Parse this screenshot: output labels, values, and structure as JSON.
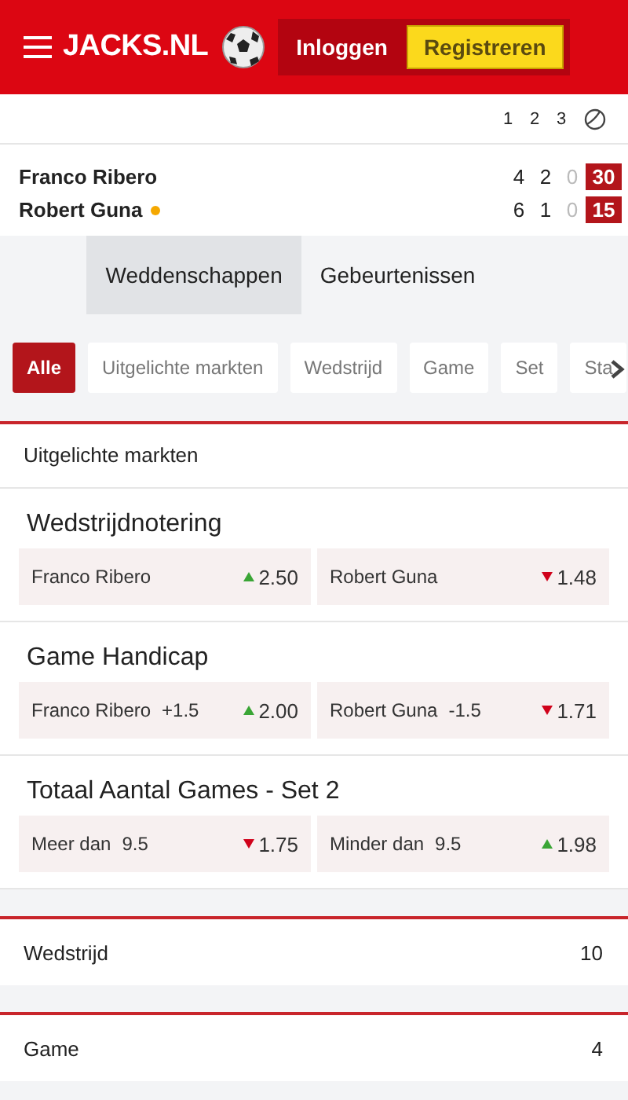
{
  "header": {
    "logo": "JACKS.NL",
    "login": "Inloggen",
    "register": "Registreren"
  },
  "scoreboard": {
    "columns": [
      "1",
      "2",
      "3"
    ],
    "players": [
      {
        "name": "Franco Ribero",
        "serving": false,
        "sets": [
          {
            "value": "4",
            "dim": false
          },
          {
            "value": "2",
            "dim": false
          },
          {
            "value": "0",
            "dim": true
          }
        ],
        "points": "30"
      },
      {
        "name": "Robert Guna",
        "serving": true,
        "sets": [
          {
            "value": "6",
            "dim": false
          },
          {
            "value": "1",
            "dim": false
          },
          {
            "value": "0",
            "dim": true
          }
        ],
        "points": "15"
      }
    ]
  },
  "tabs": [
    {
      "label": "Weddenschappen",
      "selected": true
    },
    {
      "label": "Gebeurtenissen",
      "selected": false
    }
  ],
  "filters": [
    {
      "label": "Alle",
      "selected": true
    },
    {
      "label": "Uitgelichte markten",
      "selected": false
    },
    {
      "label": "Wedstrijd",
      "selected": false
    },
    {
      "label": "Game",
      "selected": false
    },
    {
      "label": "Set",
      "selected": false
    },
    {
      "label": "Sta",
      "selected": false
    }
  ],
  "featured_title": "Uitgelichte markten",
  "markets": [
    {
      "title": "Wedstrijdnotering",
      "outcomes": [
        {
          "name": "Franco Ribero",
          "odds": "2.50",
          "rising": true
        },
        {
          "name": "Robert Guna",
          "odds": "1.48",
          "rising": false
        }
      ]
    },
    {
      "title": "Game Handicap",
      "outcomes": [
        {
          "name": "Franco Ribero",
          "line": "+1.5",
          "odds": "2.00",
          "rising": true
        },
        {
          "name": "Robert Guna",
          "line": "-1.5",
          "odds": "1.71",
          "rising": false
        }
      ]
    },
    {
      "title": "Totaal Aantal Games - Set 2",
      "outcomes": [
        {
          "name": "Meer dan",
          "line": "9.5",
          "odds": "1.75",
          "rising": false
        },
        {
          "name": "Minder dan",
          "line": "9.5",
          "odds": "1.98",
          "rising": true
        }
      ]
    }
  ],
  "categories": [
    {
      "label": "Wedstrijd",
      "count": "10"
    },
    {
      "label": "Game",
      "count": "4"
    }
  ]
}
